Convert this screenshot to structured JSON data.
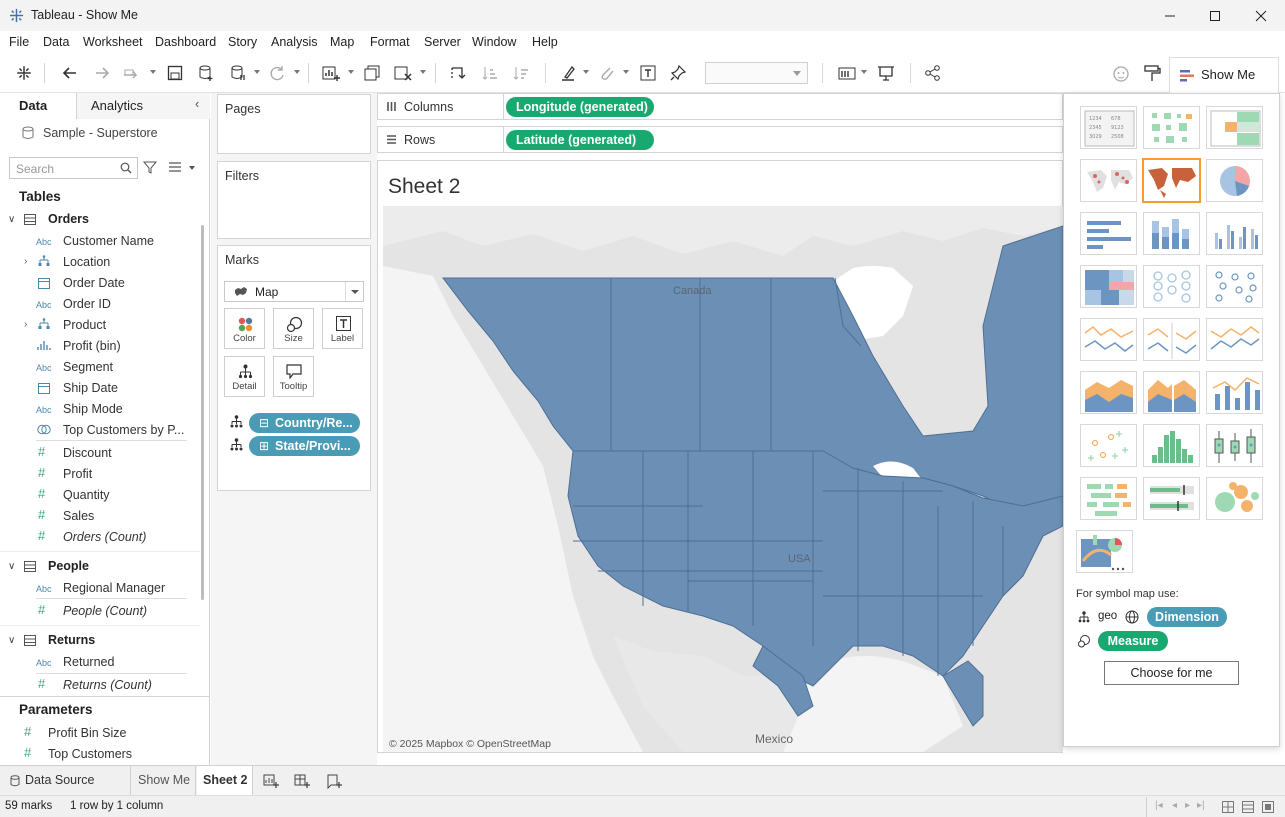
{
  "window": {
    "title": "Tableau - Show Me"
  },
  "menu": [
    "File",
    "Data",
    "Worksheet",
    "Dashboard",
    "Story",
    "Analysis",
    "Map",
    "Format",
    "Server",
    "Window",
    "Help"
  ],
  "toolbar": {
    "show_me_label": "Show Me"
  },
  "left_panel": {
    "tab_data": "Data",
    "tab_analytics": "Analytics",
    "datasource": "Sample - Superstore",
    "search_placeholder": "Search",
    "tables_header": "Tables",
    "orders": {
      "name": "Orders",
      "fields": [
        "Customer Name",
        "Location",
        "Order Date",
        "Order ID",
        "Product",
        "Profit (bin)",
        "Segment",
        "Ship Date",
        "Ship Mode",
        "Top Customers by P...",
        "Discount",
        "Profit",
        "Quantity",
        "Sales",
        "Orders (Count)"
      ]
    },
    "people": {
      "name": "People",
      "fields": [
        "Regional Manager",
        "People (Count)"
      ]
    },
    "returns": {
      "name": "Returns",
      "fields": [
        "Returned",
        "Returns (Count)"
      ]
    },
    "parameters_header": "Parameters",
    "parameters": [
      "Profit Bin Size",
      "Top Customers"
    ]
  },
  "cards": {
    "pages": "Pages",
    "filters": "Filters",
    "marks": "Marks",
    "mark_type": "Map",
    "mark_buttons": [
      "Color",
      "Size",
      "Label",
      "Detail",
      "Tooltip"
    ],
    "mark_pills": [
      "Country/Re...",
      "State/Provi..."
    ]
  },
  "shelves": {
    "columns_label": "Columns",
    "columns_pill": "Longitude (generated)",
    "rows_label": "Rows",
    "rows_pill": "Latitude (generated)"
  },
  "sheet": {
    "title": "Sheet 2",
    "map_label_canada": "Canada",
    "map_label_usa": "USA",
    "map_label_mexico": "Mexico",
    "attribution": "© 2025 Mapbox © OpenStreetMap"
  },
  "show_me": {
    "hint": "For symbol map use:",
    "geo_label": "geo",
    "dimension_pill": "Dimension",
    "measure_pill": "Measure",
    "choose_button": "Choose for me"
  },
  "sheet_tabs": [
    "Data Source",
    "Show Me",
    "Sheet 2"
  ],
  "status": {
    "marks": "59 marks",
    "rows_cols": "1 row by 1 column"
  },
  "colors": {
    "map_fill": "#6b8fb5",
    "green_pill": "#1aa871",
    "blue_pill": "#4a9bb5",
    "selected_thumb": "#f59b2f"
  }
}
